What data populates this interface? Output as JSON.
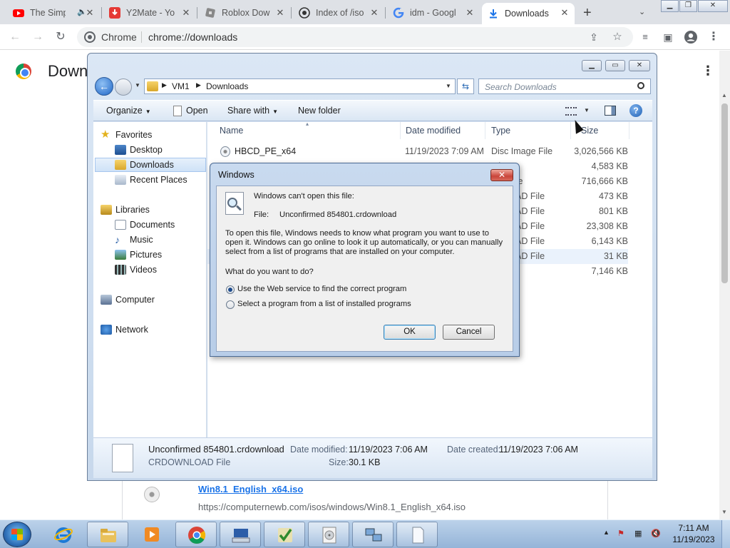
{
  "chrome": {
    "tabs": [
      {
        "title": "The Simp",
        "favicon": "youtube-icon",
        "has_audio": true
      },
      {
        "title": "Y2Mate - Yo",
        "favicon": "y2mate-icon"
      },
      {
        "title": "Roblox Dow",
        "favicon": "roblox-icon"
      },
      {
        "title": "Index of /iso",
        "favicon": "index-icon"
      },
      {
        "title": "idm - Googl",
        "favicon": "google-icon"
      },
      {
        "title": "Downloads",
        "favicon": "download-icon",
        "active": true
      }
    ],
    "close_glyph": "✕",
    "address": {
      "site_chip": "Chrome",
      "url": "chrome://downloads"
    }
  },
  "downloads_page": {
    "title": "Downloads",
    "item": {
      "file_name": "Win8.1_English_x64.iso",
      "url": "https://computernewb.com/isos/windows/Win8.1_English_x64.iso"
    }
  },
  "explorer": {
    "breadcrumb": [
      "VM1",
      "Downloads"
    ],
    "search_placeholder": "Search Downloads",
    "commands": {
      "organize": "Organize",
      "open": "Open",
      "share_with": "Share with",
      "new_folder": "New folder"
    },
    "nav": {
      "favorites": "Favorites",
      "favorite_items": [
        "Desktop",
        "Downloads",
        "Recent Places"
      ],
      "libraries": "Libraries",
      "library_items": [
        "Documents",
        "Music",
        "Pictures",
        "Videos"
      ],
      "computer": "Computer",
      "network": "Network"
    },
    "columns": {
      "name": "Name",
      "date": "Date modified",
      "type": "Type",
      "size": "Size"
    },
    "files": [
      {
        "name": "HBCD_PE_x64",
        "date": "11/19/2023 7:09 AM",
        "type": "Disc Image File",
        "size": "3,026,566 KB"
      },
      {
        "type": "ation",
        "size": "4,583 KB"
      },
      {
        "type": "age File",
        "size": "716,666 KB"
      },
      {
        "type": "VNLOAD File",
        "size": "473 KB"
      },
      {
        "type": "VNLOAD File",
        "size": "801 KB"
      },
      {
        "type": "VNLOAD File",
        "size": "23,308 KB"
      },
      {
        "type": "VNLOAD File",
        "size": "6,143 KB"
      },
      {
        "type": "VNLOAD File",
        "size": "31 KB"
      },
      {
        "type": "deo",
        "size": "7,146 KB"
      }
    ],
    "details": {
      "file_name": "Unconfirmed 854801.crdownload",
      "file_type": "CRDOWNLOAD File",
      "date_modified_label": "Date modified:",
      "date_modified": "11/19/2023 7:06 AM",
      "date_created_label": "Date created:",
      "date_created": "11/19/2023 7:06 AM",
      "size_label": "Size:",
      "size": "30.1 KB"
    }
  },
  "dialog": {
    "title": "Windows",
    "heading": "Windows can't open this file:",
    "file_label": "File:",
    "file_name": "Unconfirmed 854801.crdownload",
    "description_lines": [
      "To open this file, Windows needs to know what program you want to use to",
      "open it. Windows can go online to look it up automatically, or you can manually",
      "select from a list of programs that are installed on your computer."
    ],
    "question": "What do you want to do?",
    "options": [
      {
        "label": "Use the Web service to find the correct program",
        "selected": true
      },
      {
        "label": "Select a program from a list of installed programs",
        "selected": false
      }
    ],
    "ok": "OK",
    "cancel": "Cancel"
  },
  "taskbar": {
    "clock_time": "7:11 AM",
    "clock_date": "11/19/2023"
  }
}
